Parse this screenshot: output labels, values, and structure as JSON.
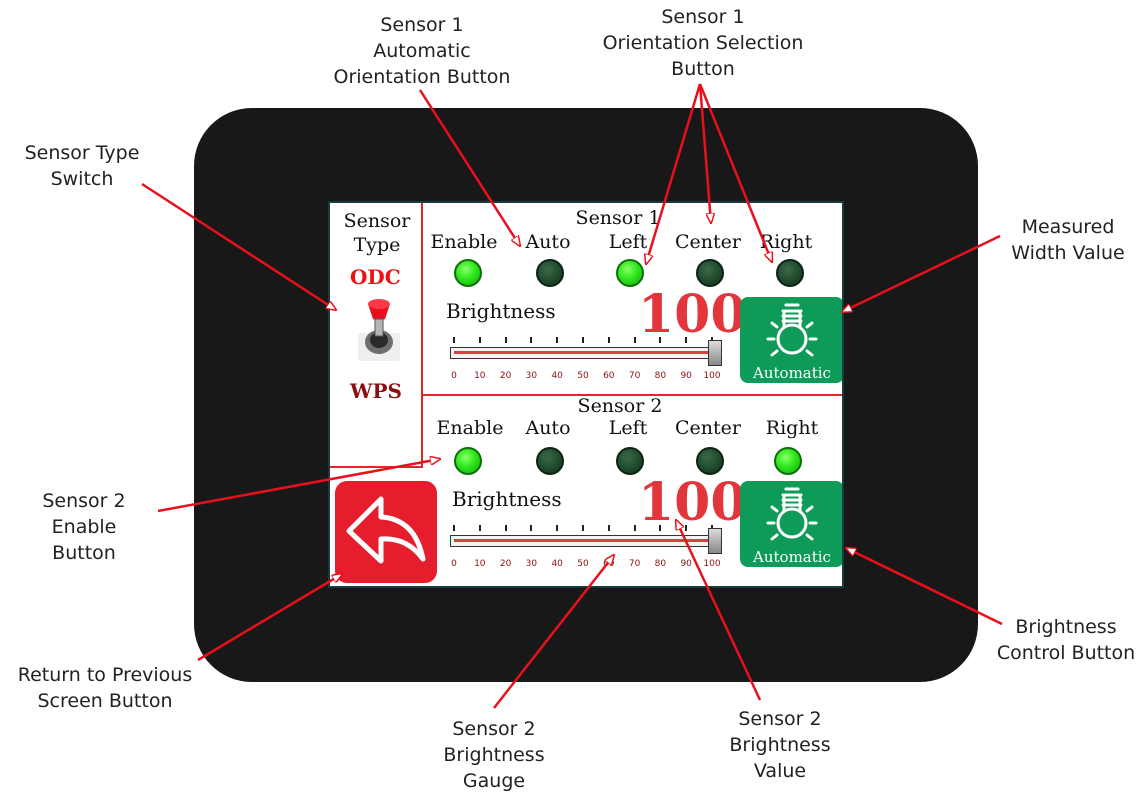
{
  "callouts": {
    "sensor1_auto_orientation": "Sensor 1\nAutomatic\nOrientation Button",
    "sensor1_orientation_selection": "Sensor 1\nOrientation Selection\nButton",
    "sensor_type_switch": "Sensor Type\nSwitch",
    "measured_width_value": "Measured\nWidth Value",
    "sensor2_enable": "Sensor 2\nEnable\nButton",
    "return_previous": "Return to Previous\nScreen Button",
    "sensor2_gauge": "Sensor 2\nBrightness\nGauge",
    "sensor2_value": "Sensor 2\nBrightness\nValue",
    "brightness_control": "Brightness\nControl Button"
  },
  "sidebar": {
    "sensor_type_label": "Sensor\nType",
    "odc": "ODC",
    "wps": "WPS"
  },
  "sensor1": {
    "title": "Sensor 1",
    "labels": [
      "Enable",
      "Auto",
      "Left",
      "Center",
      "Right"
    ],
    "states": [
      true,
      false,
      true,
      false,
      false
    ],
    "brightness_label": "Brightness",
    "brightness_value": "100",
    "gauge_level": 100,
    "auto_button": "Automatic"
  },
  "sensor2": {
    "title": "Sensor 2",
    "labels": [
      "Enable",
      "Auto",
      "Left",
      "Center",
      "Right"
    ],
    "states": [
      true,
      false,
      false,
      false,
      true
    ],
    "brightness_label": "Brightness",
    "brightness_value": "100",
    "gauge_level": 100,
    "auto_button": "Automatic"
  },
  "gauge_ticks": [
    "0",
    "10",
    "20",
    "30",
    "40",
    "50",
    "60",
    "70",
    "80",
    "90",
    "100"
  ],
  "icons": {
    "switch": "toggle-switch-icon",
    "bulb": "lightbulb-icon",
    "back": "back-arrow-icon"
  },
  "colors": {
    "led_on": "#2ee81a",
    "led_off": "#1f4a2c",
    "accent_red": "#e3363c",
    "auto_green": "#0d9b57",
    "back_red": "#e51d2c",
    "bezel": "#181818"
  }
}
